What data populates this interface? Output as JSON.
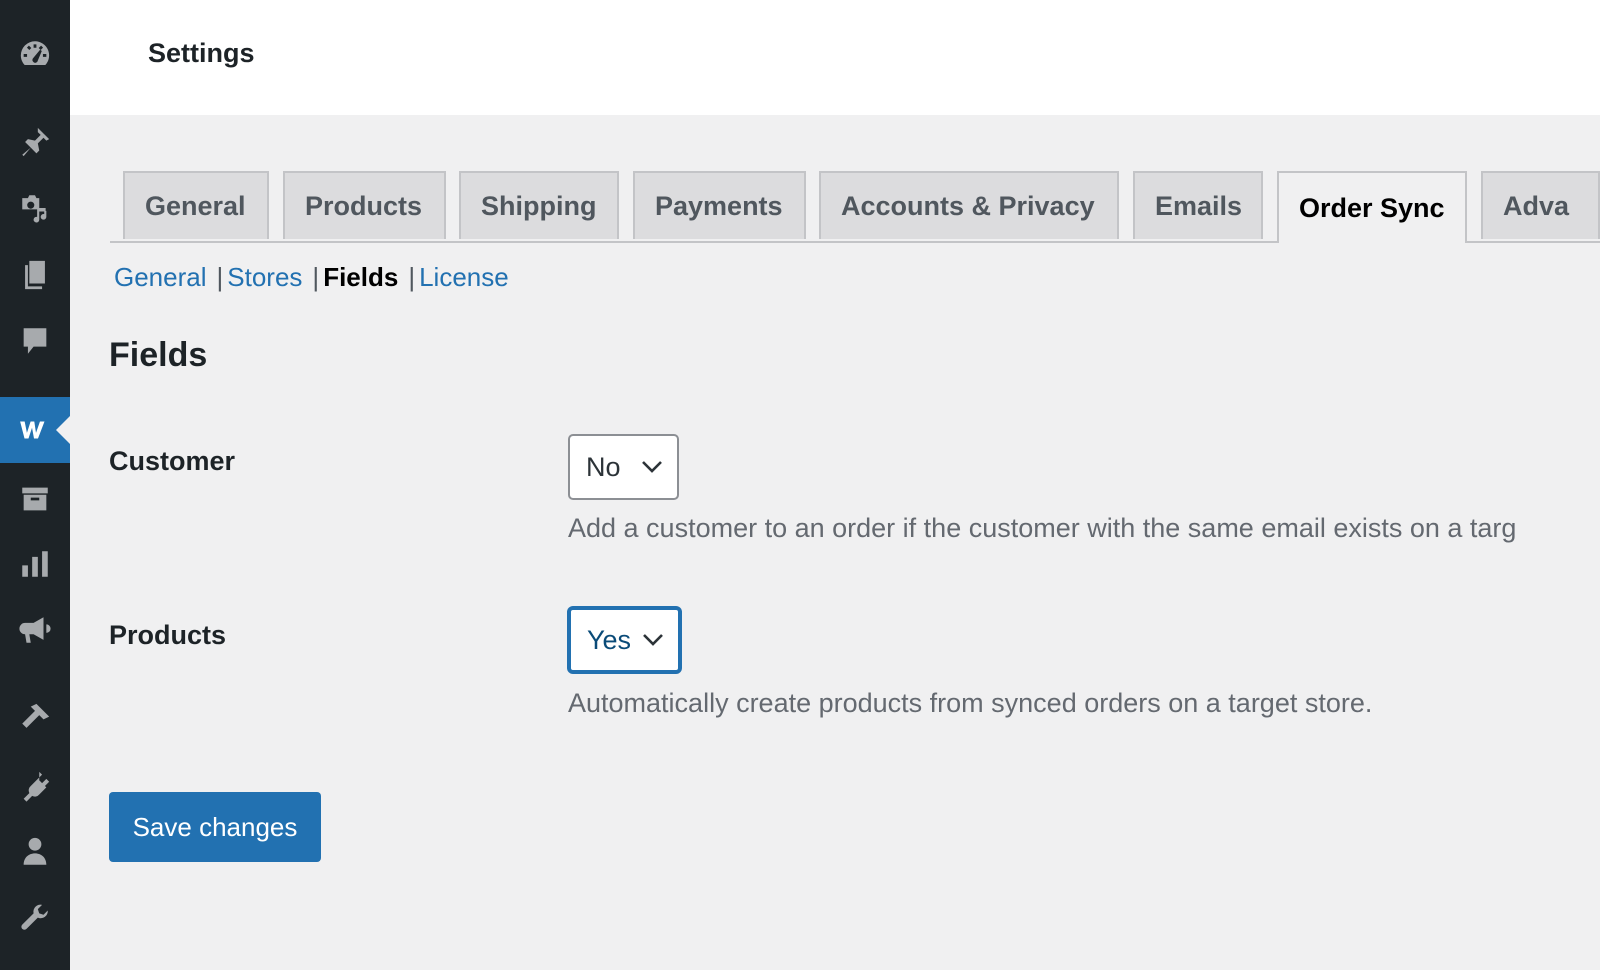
{
  "header": {
    "title": "Settings"
  },
  "sidebar": {
    "items": [
      {
        "icon": "dashboard-icon"
      },
      {
        "icon": "pin-icon"
      },
      {
        "icon": "media-icon"
      },
      {
        "icon": "pages-icon"
      },
      {
        "icon": "comments-icon"
      },
      {
        "icon": "woocommerce-icon",
        "active": true
      },
      {
        "icon": "archive-icon"
      },
      {
        "icon": "analytics-icon"
      },
      {
        "icon": "megaphone-icon"
      },
      {
        "icon": "appearance-icon"
      },
      {
        "icon": "plugins-icon"
      },
      {
        "icon": "users-icon"
      },
      {
        "icon": "tools-icon"
      }
    ]
  },
  "tabs": [
    {
      "label": "General"
    },
    {
      "label": "Products"
    },
    {
      "label": "Shipping"
    },
    {
      "label": "Payments"
    },
    {
      "label": "Accounts & Privacy"
    },
    {
      "label": "Emails"
    },
    {
      "label": "Order Sync",
      "active": true
    },
    {
      "label": "Adva"
    }
  ],
  "subnav": {
    "items": [
      "General",
      "Stores",
      "Fields",
      "License"
    ],
    "separator": "|",
    "current": "Fields"
  },
  "section": {
    "title": "Fields"
  },
  "fields": {
    "customer": {
      "label": "Customer",
      "value": "No",
      "description": "Add a customer to an order if the customer with the same email exists on a targ"
    },
    "products": {
      "label": "Products",
      "value": "Yes",
      "description": "Automatically create products from synced orders on a target store."
    }
  },
  "actions": {
    "save_label": "Save changes"
  },
  "colors": {
    "sidebar_bg": "#1d2327",
    "accent": "#2271b1",
    "page_bg": "#f0f0f1"
  }
}
